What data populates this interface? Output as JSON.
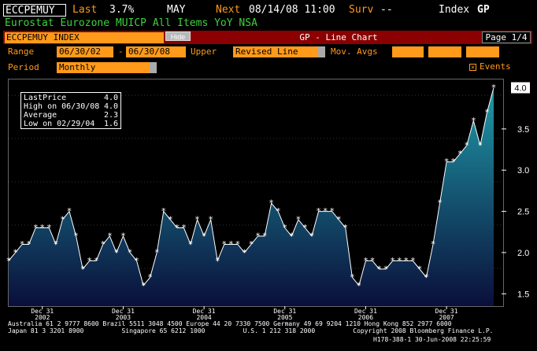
{
  "header": {
    "ticker": "ECCPEMUY",
    "last_label": "Last",
    "last_value": "3.7%",
    "month": "MAY",
    "next_label": "Next",
    "next_value": "08/14/08 11:00",
    "surv_label": "Surv",
    "surv_value": "--",
    "index_label": "Index",
    "gp_label": "GP",
    "description": "Eurostat Eurozone MUICP All Items YoY NSA"
  },
  "toolbar": {
    "index_field": "ECCPEMUY INDEX",
    "hide_label": "Hide",
    "chart_name": "GP - Line Chart",
    "page": "Page 1/4"
  },
  "controls": {
    "range_label": "Range",
    "range_start": "06/30/02",
    "range_dash": "-",
    "range_end": "06/30/08",
    "upper_label": "Upper",
    "upper_value": "Revised Line",
    "mov_avgs_label": "Mov. Avgs",
    "period_label": "Period",
    "period_value": "Monthly",
    "events_label": "Events",
    "events_check": "×"
  },
  "stats": {
    "rows": [
      {
        "label": "LastPrice",
        "value": "4.0"
      },
      {
        "label": "High on 06/30/08",
        "value": "4.0"
      },
      {
        "label": "Average",
        "value": "2.3"
      },
      {
        "label": "Low on 02/29/04",
        "value": "1.6"
      }
    ]
  },
  "chart_data": {
    "type": "area",
    "x_start": "2002-07",
    "x_end": "2008-06",
    "frequency": "monthly",
    "values": [
      1.9,
      2.0,
      2.1,
      2.1,
      2.3,
      2.3,
      2.3,
      2.1,
      2.4,
      2.5,
      2.2,
      1.8,
      1.9,
      1.9,
      2.1,
      2.2,
      2.0,
      2.2,
      2.0,
      1.9,
      1.6,
      1.7,
      2.0,
      2.5,
      2.4,
      2.3,
      2.3,
      2.1,
      2.4,
      2.2,
      2.4,
      1.9,
      2.1,
      2.1,
      2.1,
      2.0,
      2.1,
      2.2,
      2.2,
      2.6,
      2.5,
      2.3,
      2.2,
      2.4,
      2.3,
      2.2,
      2.5,
      2.5,
      2.5,
      2.4,
      2.3,
      1.7,
      1.6,
      1.9,
      1.9,
      1.8,
      1.8,
      1.9,
      1.9,
      1.9,
      1.9,
      1.8,
      1.7,
      2.1,
      2.6,
      3.1,
      3.1,
      3.2,
      3.3,
      3.6,
      3.3,
      3.7,
      4.0
    ],
    "x_tick_labels": [
      {
        "top": "Dec 31",
        "bottom": "2002"
      },
      {
        "top": "Dec 31",
        "bottom": "2003"
      },
      {
        "top": "Dec 31",
        "bottom": "2004"
      },
      {
        "top": "Dec 31",
        "bottom": "2005"
      },
      {
        "top": "Dec 31",
        "bottom": "2006"
      },
      {
        "top": "Dec 31",
        "bottom": "2007"
      }
    ],
    "y_ticks": [
      "1.5",
      "2.0",
      "2.5",
      "3.0",
      "3.5"
    ],
    "ylim": [
      1.35,
      4.1
    ],
    "last_value_label": "4.0",
    "colors": {
      "area_top": "#1f9aa8",
      "area_bottom": "#0a0f3a",
      "line": "#ffffff"
    }
  },
  "footer": {
    "line1": "Australia 61 2 9777 8600 Brazil 5511 3048 4500 Europe 44 20 7330 7500 Germany 49 69 9204 1210 Hong Kong 852 2977 6000",
    "line2": "Japan 81 3 3201 8900          Singapore 65 6212 1000          U.S. 1 212 318 2000          Copyright 2008 Bloomberg Finance L.P.",
    "line3": "H178-388-1 30-Jun-2008 22:25:59"
  }
}
